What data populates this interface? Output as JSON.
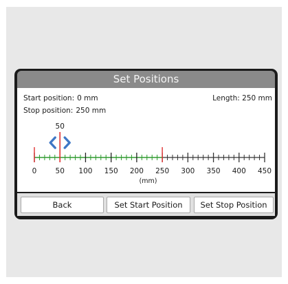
{
  "dialog": {
    "title": "Set Positions"
  },
  "info": {
    "start_label": "Start position:",
    "start_value": "0 mm",
    "stop_label": "Stop position:",
    "stop_value": "250 mm",
    "length_text": "Length: 250 mm"
  },
  "ruler": {
    "min": 0,
    "max": 450,
    "ticks": [
      "0",
      "50",
      "100",
      "150",
      "200",
      "250",
      "300",
      "350",
      "400",
      "450"
    ],
    "unit_label": "(mm)",
    "start": 0,
    "stop": 250,
    "cursor": 50,
    "cursor_label": "50",
    "colors": {
      "active": "#2e9a2e",
      "inactive": "#333333",
      "marker": "#e03030",
      "arrow": "#3f78c6"
    },
    "icons": {
      "left": "chevron-left-icon",
      "right": "chevron-right-icon"
    }
  },
  "buttons": {
    "back": "Back",
    "set_start": "Set Start Position",
    "set_stop": "Set Stop Position"
  }
}
